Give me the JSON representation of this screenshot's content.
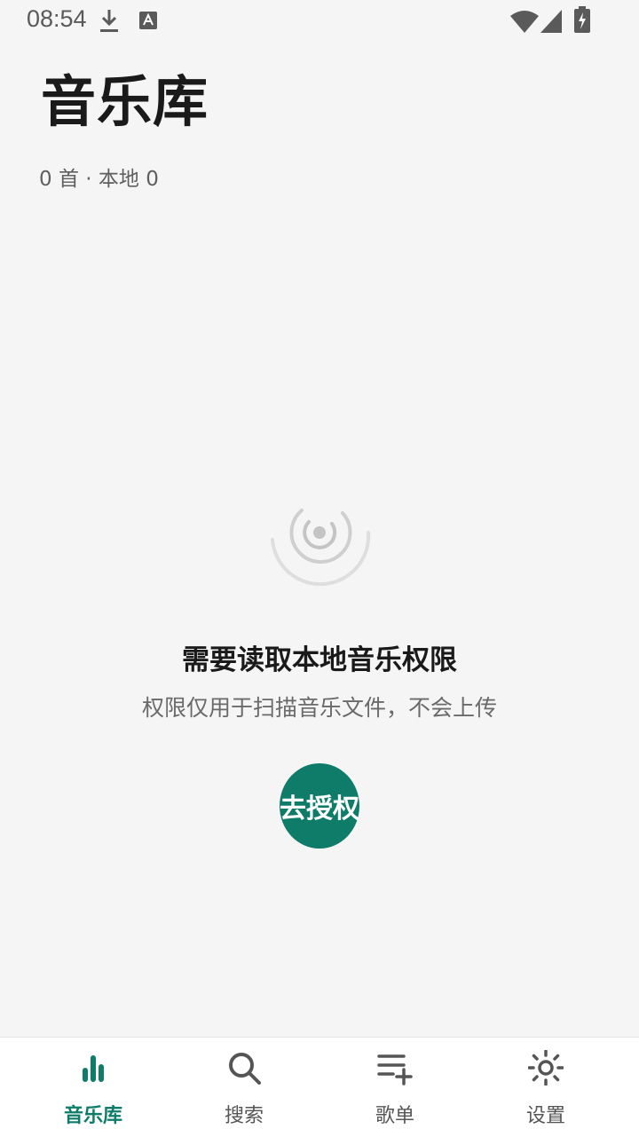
{
  "status_bar": {
    "time": "08:54",
    "left_icons": [
      "download-icon",
      "keyboard-icon"
    ],
    "right_icons": [
      "wifi-icon",
      "signal-icon",
      "battery-charging-icon"
    ]
  },
  "header": {
    "title": "音乐库",
    "subtitle": "0 首 · 本地 0"
  },
  "empty_state": {
    "icon": "music-radar-icon",
    "title": "需要读取本地音乐权限",
    "description": "权限仅用于扫描音乐文件，不会上传",
    "button_label": "去授权"
  },
  "bottom_nav": {
    "items": [
      {
        "label": "音乐库",
        "icon": "library-bars-icon",
        "active": true
      },
      {
        "label": "搜索",
        "icon": "search-icon",
        "active": false
      },
      {
        "label": "歌单",
        "icon": "playlist-add-icon",
        "active": false
      },
      {
        "label": "设置",
        "icon": "settings-sun-icon",
        "active": false
      }
    ]
  },
  "colors": {
    "accent": "#0e7c68",
    "background": "#f5f5f5",
    "nav_background": "#ffffff",
    "text_primary": "#1a1a1a",
    "text_secondary": "#6a6a6a"
  }
}
